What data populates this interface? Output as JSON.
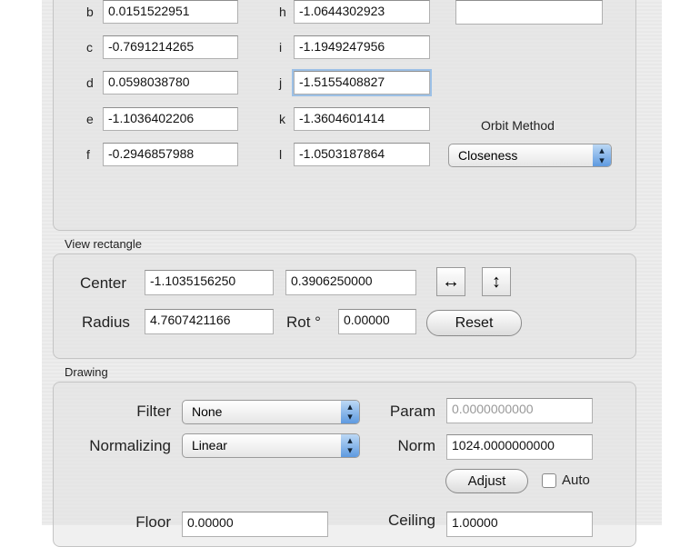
{
  "params": {
    "left": [
      {
        "label": "b",
        "value": "0.0151522951"
      },
      {
        "label": "c",
        "value": "-0.7691214265"
      },
      {
        "label": "d",
        "value": "0.0598038780"
      },
      {
        "label": "e",
        "value": "-1.1036402206"
      },
      {
        "label": "f",
        "value": "-0.2946857988"
      }
    ],
    "right": [
      {
        "label": "h",
        "value": "-1.0644302923"
      },
      {
        "label": "i",
        "value": "-1.1949247956"
      },
      {
        "label": "j",
        "value": "-1.5155408827"
      },
      {
        "label": "k",
        "value": "-1.3604601414"
      },
      {
        "label": "l",
        "value": "-1.0503187864"
      }
    ],
    "extra_value": "",
    "orbit_method_label": "Orbit Method",
    "orbit_method_value": "Closeness"
  },
  "view": {
    "title": "View rectangle",
    "center_label": "Center",
    "center_x": "-1.1035156250",
    "center_y": "0.3906250000",
    "radius_label": "Radius",
    "radius": "4.7607421166",
    "rot_label": "Rot °",
    "rot": "0.00000",
    "reset_label": "Reset"
  },
  "drawing": {
    "title": "Drawing",
    "filter_label": "Filter",
    "filter_value": "None",
    "param_label": "Param",
    "param_value": "0.0000000000",
    "normalizing_label": "Normalizing",
    "normalizing_value": "Linear",
    "norm_label": "Norm",
    "norm_value": "1024.0000000000",
    "adjust_label": "Adjust",
    "auto_label": "Auto",
    "floor_label": "Floor",
    "floor_value": "0.00000",
    "ceiling_label": "Ceiling",
    "ceiling_value": "1.00000"
  }
}
